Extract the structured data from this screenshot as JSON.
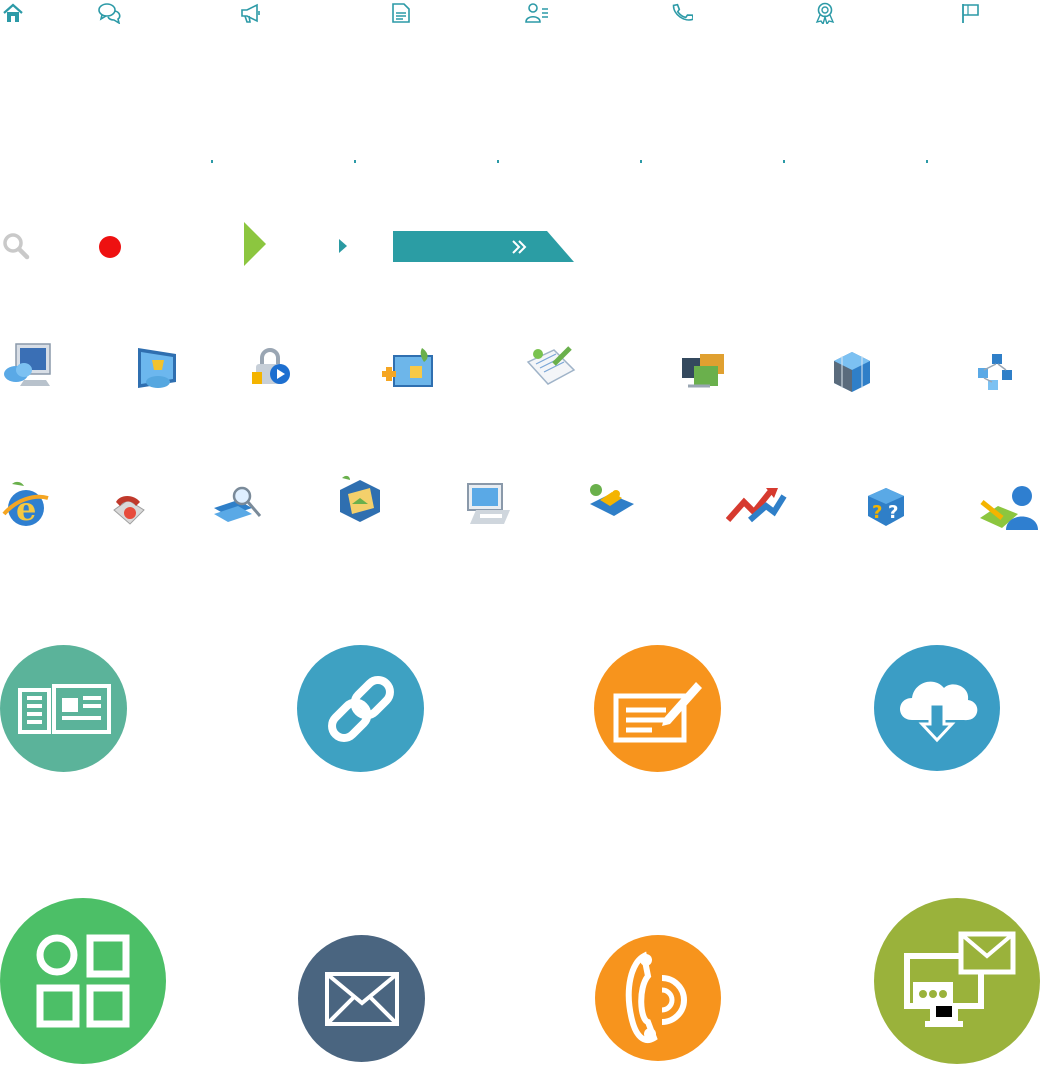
{
  "colors": {
    "teal_nav": "#2c9aa7",
    "search_gray": "#c9c9c9",
    "red_dot": "#ee1111",
    "lime": "#8cc63f",
    "teal_arrow": "#2a9aa2",
    "banner": "#2b9da4",
    "circle_green_teal": "#5bb39a",
    "circle_blue": "#3ea1c2",
    "circle_orange": "#f7941d",
    "circle_cloud_blue": "#3b9dc5",
    "circle_green": "#4cbf67",
    "circle_slate": "#4a6580",
    "circle_olive": "#9ab23b"
  },
  "nav_icons": [
    "home-icon",
    "chat-icon",
    "megaphone-icon",
    "document-icon",
    "user-list-icon",
    "phone-icon",
    "award-icon",
    "flag-icon"
  ],
  "banner": {
    "arrows": "»"
  },
  "row3d_1": [
    "monitor-cloud-icon",
    "screen-trophy-icon",
    "lock-play-icon",
    "add-window-icon",
    "notepad-pencil-icon",
    "photo-gallery-icon",
    "cube-stack-icon",
    "network-nodes-icon"
  ],
  "row3d_2": [
    "ie-browser-icon",
    "telephone-icon",
    "books-search-icon",
    "photo-cube-icon",
    "printer-monitor-icon",
    "puzzle-icon",
    "growth-arrows-icon",
    "help-box-icon",
    "user-messenger-icon"
  ],
  "circles": [
    "news-circle-icon",
    "link-circle-icon",
    "edit-circle-icon",
    "cloud-download-circle-icon",
    "apps-circle-icon",
    "mail-circle-icon",
    "phone-circle-icon",
    "monitor-mail-circle-icon"
  ]
}
